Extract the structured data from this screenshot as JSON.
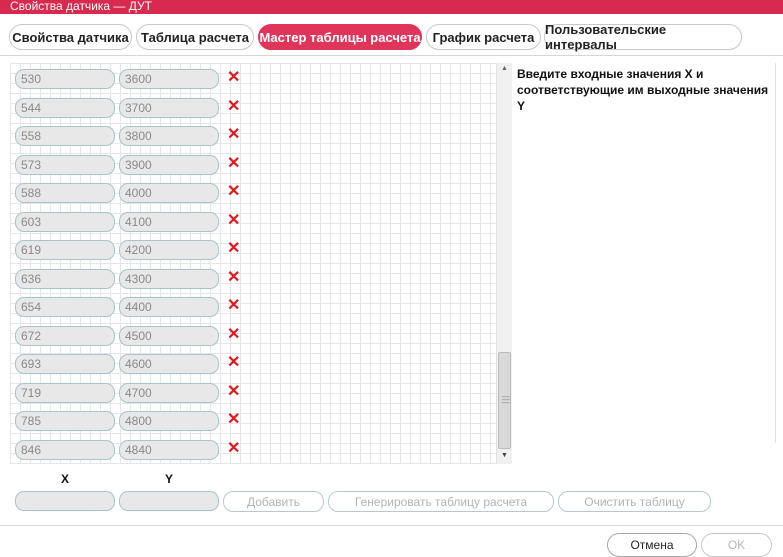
{
  "window": {
    "title": "Свойства датчика — ДУТ"
  },
  "tabs": [
    {
      "label": "Свойства датчика"
    },
    {
      "label": "Таблица расчета"
    },
    {
      "label": "Мастер таблицы расчета"
    },
    {
      "label": "График расчета"
    },
    {
      "label": "Пользовательские интервалы"
    }
  ],
  "rows": [
    {
      "x": "530",
      "y": "3600"
    },
    {
      "x": "544",
      "y": "3700"
    },
    {
      "x": "558",
      "y": "3800"
    },
    {
      "x": "573",
      "y": "3900"
    },
    {
      "x": "588",
      "y": "4000"
    },
    {
      "x": "603",
      "y": "4100"
    },
    {
      "x": "619",
      "y": "4200"
    },
    {
      "x": "636",
      "y": "4300"
    },
    {
      "x": "654",
      "y": "4400"
    },
    {
      "x": "672",
      "y": "4500"
    },
    {
      "x": "693",
      "y": "4600"
    },
    {
      "x": "719",
      "y": "4700"
    },
    {
      "x": "785",
      "y": "4800"
    },
    {
      "x": "846",
      "y": "4840"
    }
  ],
  "delete_glyph": "✕",
  "help_text": "Введите входные значения X и соответствующие им выходные значения Y",
  "columns": {
    "x_label": "X",
    "y_label": "Y"
  },
  "new_row": {
    "x": "",
    "y": ""
  },
  "buttons": {
    "add": "Добавить",
    "generate": "Генерировать таблицу расчета",
    "clear": "Очистить таблицу"
  },
  "footer": {
    "cancel": "Отмена",
    "ok": "OK"
  },
  "colors": {
    "accent": "#e0355a",
    "delete": "#e0191f"
  }
}
